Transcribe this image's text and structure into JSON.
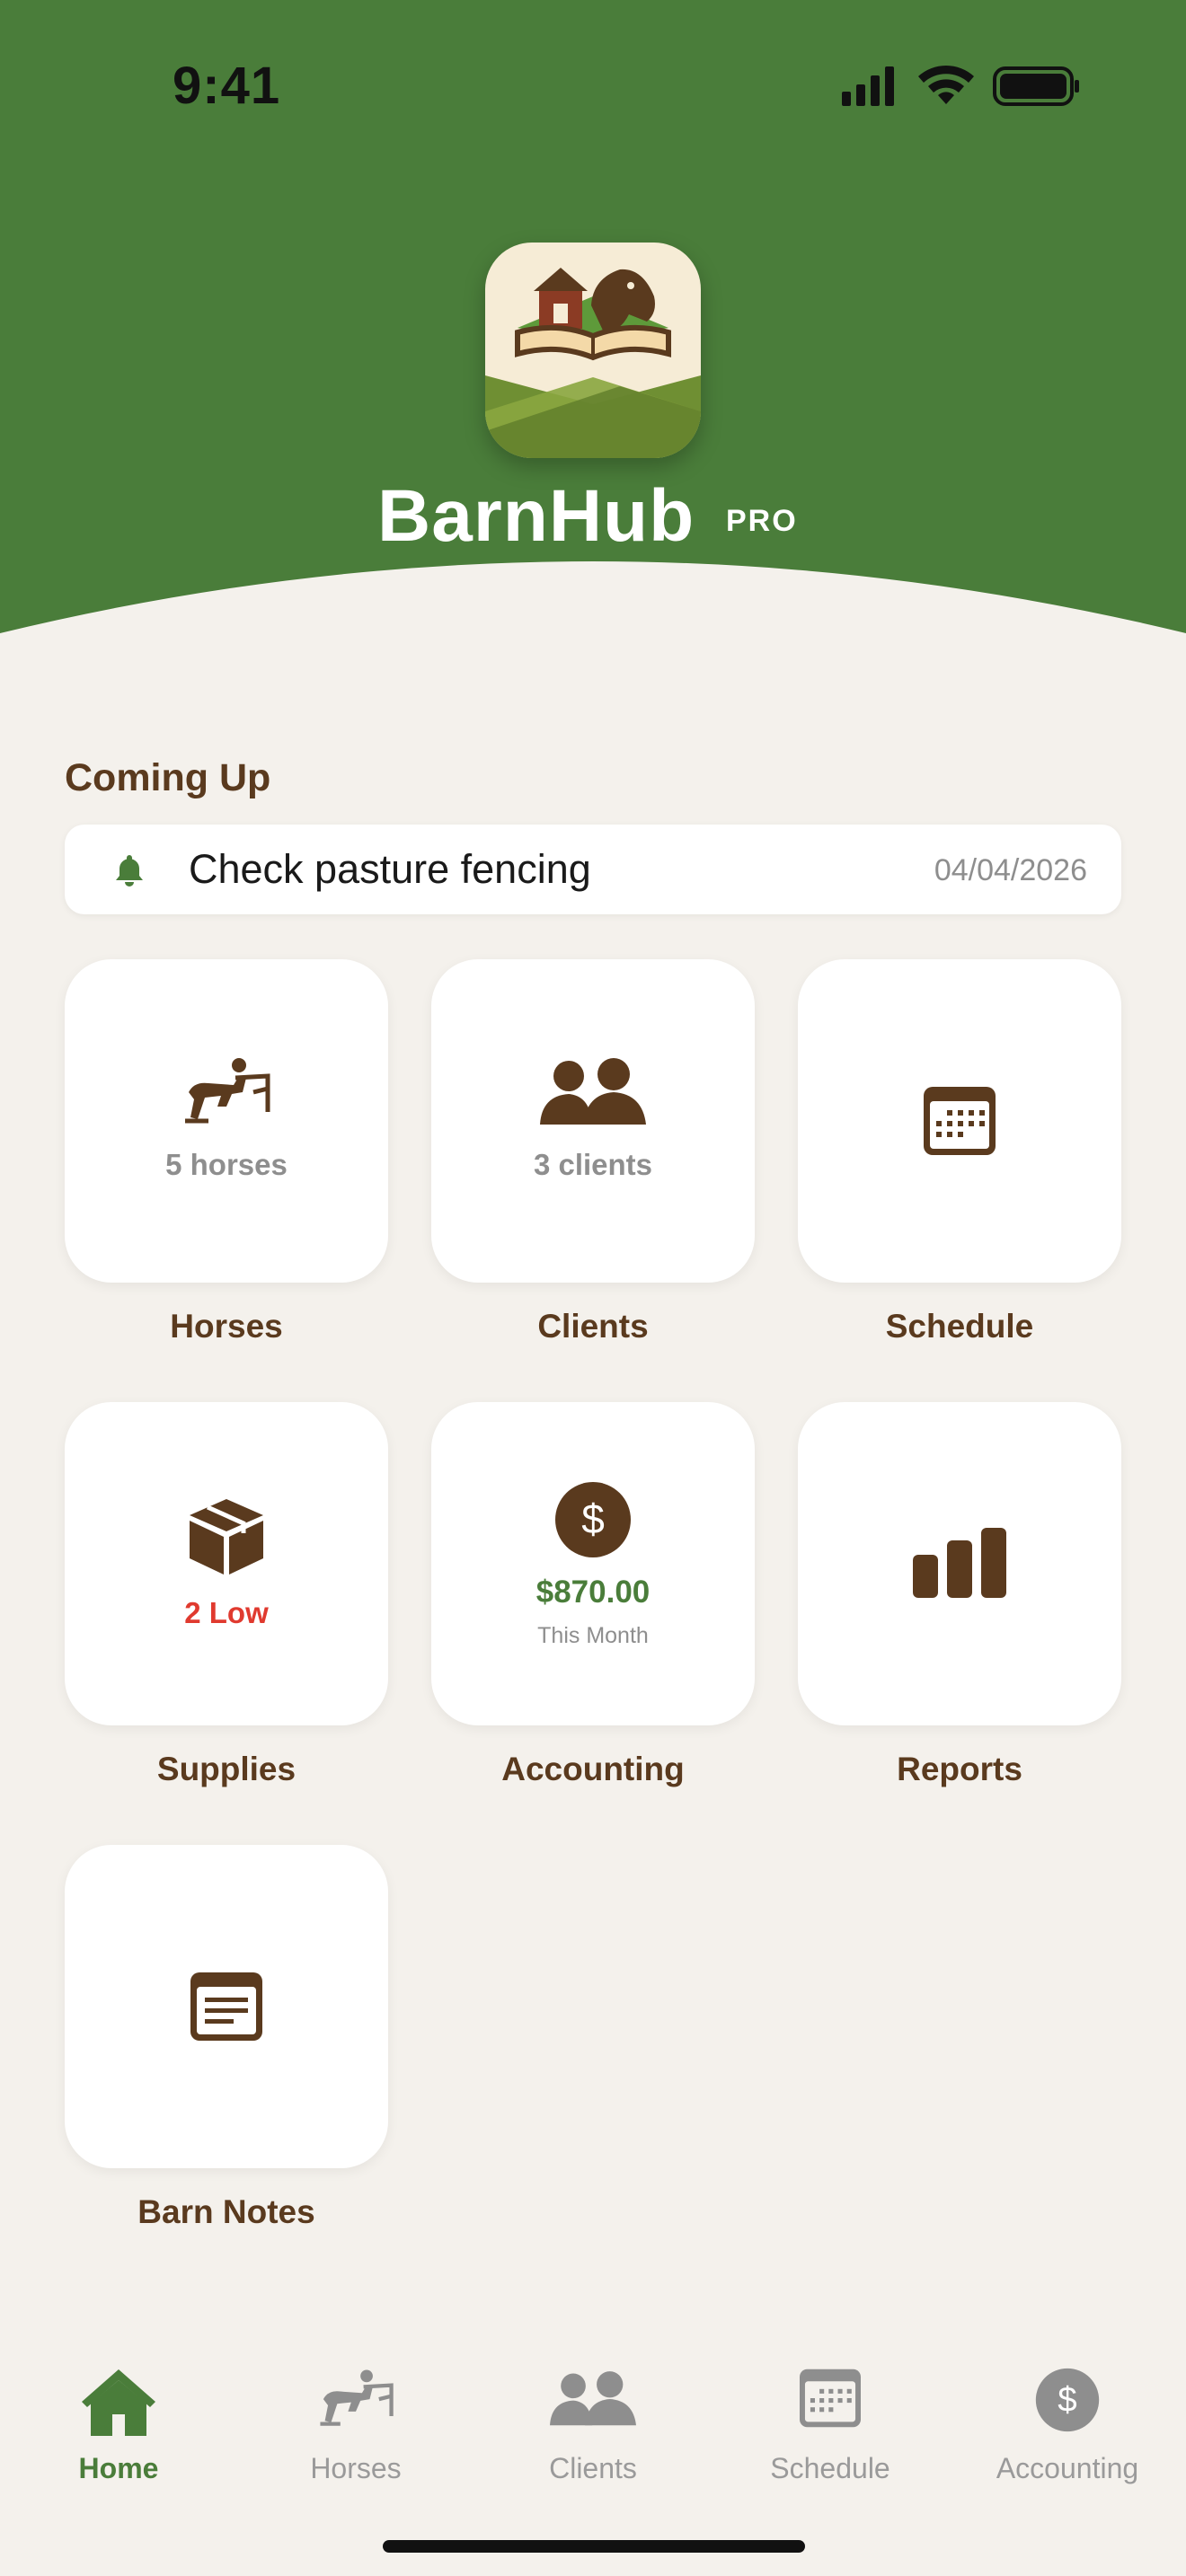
{
  "status_bar": {
    "time": "9:41"
  },
  "header": {
    "brand": "BarnHub",
    "badge": "PRO",
    "colors": {
      "green": "#4a7d3a",
      "brown": "#5a3a1e"
    }
  },
  "coming_up": {
    "title": "Coming Up",
    "items": [
      {
        "icon": "bell-icon",
        "task": "Check pasture fencing",
        "date": "04/04/2026"
      }
    ]
  },
  "tiles": [
    {
      "icon": "horse-jumping-icon",
      "sub": "5 horses",
      "label": "Horses"
    },
    {
      "icon": "people-icon",
      "sub": "3 clients",
      "label": "Clients"
    },
    {
      "icon": "calendar-icon",
      "sub": "",
      "label": "Schedule"
    },
    {
      "icon": "box-icon",
      "sub": "2 Low",
      "label": "Supplies"
    },
    {
      "icon": "dollar-icon",
      "sub": "$870.00",
      "sub2": "This Month",
      "label": "Accounting"
    },
    {
      "icon": "bar-chart-icon",
      "sub": "",
      "label": "Reports"
    },
    {
      "icon": "note-icon",
      "sub": "",
      "label": "Barn Notes"
    }
  ],
  "tabbar": {
    "items": [
      {
        "icon": "home-icon",
        "label": "Home",
        "active": true
      },
      {
        "icon": "horse-jumping-icon",
        "label": "Horses",
        "active": false
      },
      {
        "icon": "people-icon",
        "label": "Clients",
        "active": false
      },
      {
        "icon": "calendar-icon",
        "label": "Schedule",
        "active": false
      },
      {
        "icon": "dollar-icon",
        "label": "Accounting",
        "active": false
      }
    ]
  }
}
